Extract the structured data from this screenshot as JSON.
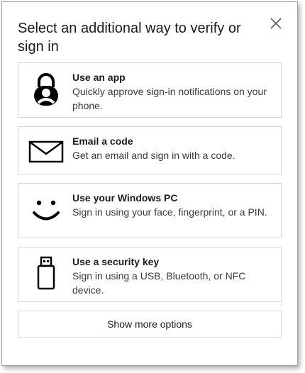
{
  "dialog": {
    "title": "Select an additional way to verify or sign in",
    "close_icon": "close-icon"
  },
  "options": [
    {
      "icon": "lock-person-icon",
      "title": "Use an app",
      "description": "Quickly approve sign-in notifications on your phone."
    },
    {
      "icon": "envelope-icon",
      "title": "Email a code",
      "description": "Get an email and sign in with a code."
    },
    {
      "icon": "smiley-face-icon",
      "title": "Use your Windows PC",
      "description": "Sign in using your face, fingerprint, or a PIN."
    },
    {
      "icon": "usb-key-icon",
      "title": "Use a security key",
      "description": "Sign in using a USB, Bluetooth, or NFC device."
    }
  ],
  "more_options_label": "Show more options"
}
